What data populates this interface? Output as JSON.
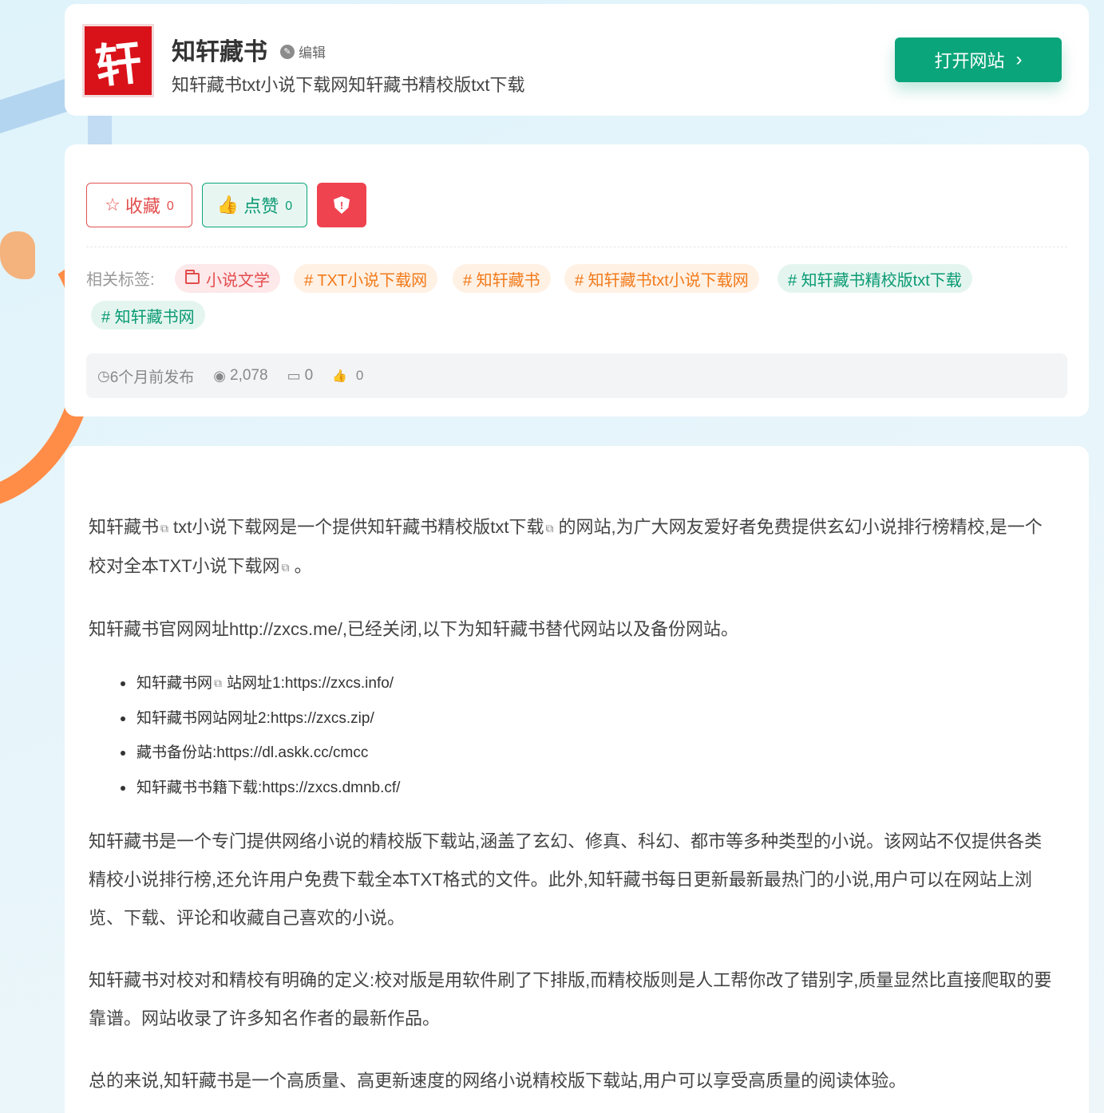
{
  "header": {
    "logo_char": "轩",
    "title": "知轩藏书",
    "edit_label": "编辑",
    "description": "知轩藏书txt小说下载网知轩藏书精校版txt下载",
    "open_button": "打开网站",
    "open_chevron": "›"
  },
  "actions": {
    "favorite_label": "收藏",
    "favorite_count": "0",
    "like_label": "点赞",
    "like_count": "0",
    "favorite_icon": "☆",
    "like_icon": "👍"
  },
  "tags": {
    "label": "相关标签:",
    "items": [
      {
        "text": "小说文学",
        "color": "#e34d4d"
      },
      {
        "text": "# TXT小说下载网",
        "color": "#f27a1a"
      },
      {
        "text": "# 知轩藏书",
        "color": "#f27a1a"
      },
      {
        "text": "# 知轩藏书txt小说下载网",
        "color": "#f27a1a"
      },
      {
        "text": "# 知轩藏书精校版txt下载",
        "color": "#0a9a73"
      },
      {
        "text": "# 知轩藏书网",
        "color": "#0a9a73"
      }
    ]
  },
  "stats": {
    "published": "6个月前发布",
    "views": "2,078",
    "comments": "0",
    "likes": "0",
    "clock_icon": "◷",
    "eye_icon": "◉",
    "comment_icon": "▭",
    "like_icon": "👍"
  },
  "content": {
    "p1_a": "知轩藏书",
    "p1_b": "txt小说下载网是一个提供知轩藏书精校版txt下载",
    "p1_c": "的网站,为广大网友爱好者免费提供玄幻小说排行榜精校,是一个校对全本TXT小说下载网",
    "p1_d": "。",
    "p2": "知轩藏书官网网址http://zxcs.me/,已经关闭,以下为知轩藏书替代网站以及备份网站。",
    "list": [
      {
        "a": "知轩藏书网",
        "b": "站网址1:https://zxcs.info/"
      },
      {
        "a": "知轩藏书网站网址2:https://zxcs.zip/"
      },
      {
        "a": "藏书备份站:https://dl.askk.cc/cmcc"
      },
      {
        "a": "知轩藏书书籍下载:https://zxcs.dmnb.cf/"
      }
    ],
    "p3": "知轩藏书是一个专门提供网络小说的精校版下载站,涵盖了玄幻、修真、科幻、都市等多种类型的小说。该网站不仅提供各类精校小说排行榜,还允许用户免费下载全本TXT格式的文件。此外,知轩藏书每日更新最新最热门的小说,用户可以在网站上浏览、下载、评论和收藏自己喜欢的小说。",
    "p4": "知轩藏书对校对和精校有明确的定义:校对版是用软件刷了下排版,而精校版则是人工帮你改了错别字,质量显然比直接爬取的要靠谱。网站收录了许多知名作者的最新作品。",
    "p5": "总的来说,知轩藏书是一个高质量、高更新速度的网络小说精校版下载站,用户可以享受高质量的阅读体验。",
    "external_icon": "⧉"
  },
  "colors": {
    "accent_green": "#0aa57a",
    "accent_red": "#ef4350",
    "accent_orange": "#f27a1a"
  }
}
